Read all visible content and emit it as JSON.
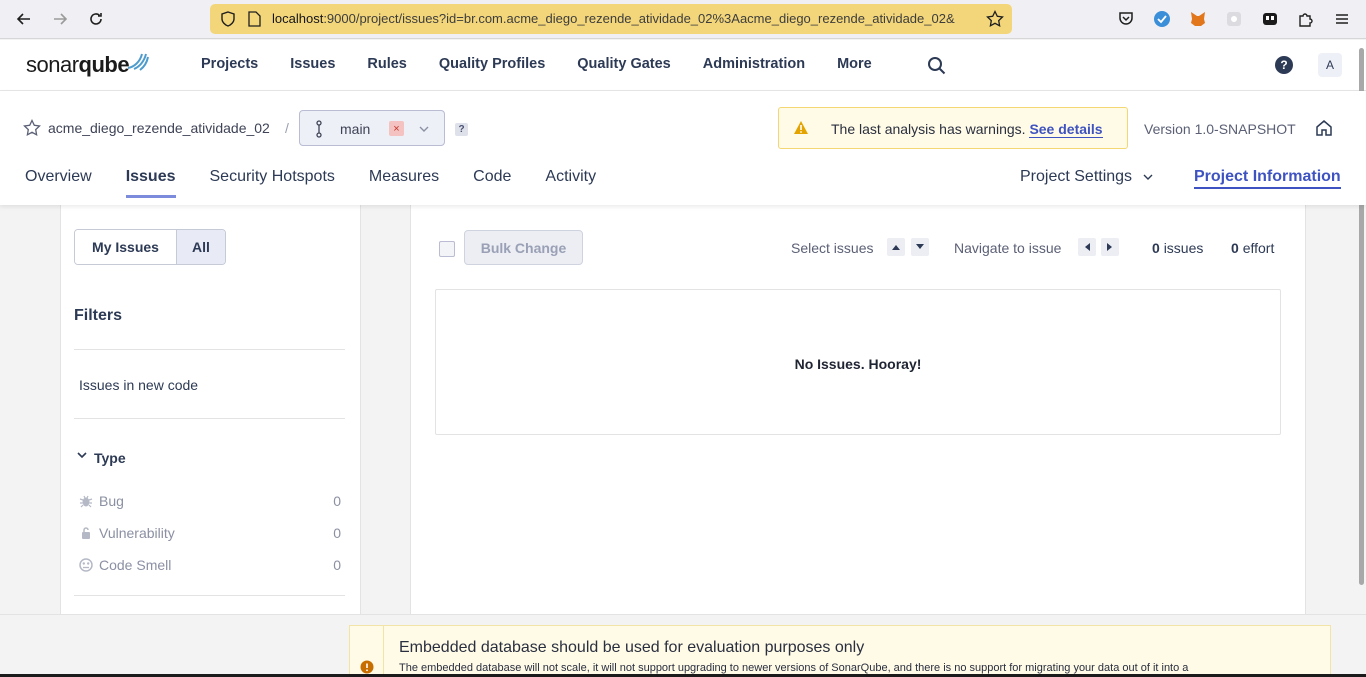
{
  "browser": {
    "url_host": "localhost",
    "url_rest": ":9000/project/issues?id=br.com.acme_diego_rezende_atividade_02%3Aacme_diego_rezende_atividade_02&"
  },
  "header": {
    "logo_light": "sonar",
    "logo_bold": "qube",
    "nav": [
      "Projects",
      "Issues",
      "Rules",
      "Quality Profiles",
      "Quality Gates",
      "Administration",
      "More"
    ],
    "avatar": "A"
  },
  "project": {
    "name": "acme_diego_rezende_atividade_02",
    "separator": "/",
    "branch": "main",
    "branch_remove": "×",
    "help": "?",
    "warning_text": "The last analysis has warnings.",
    "warning_link": "See details",
    "version": "Version 1.0-SNAPSHOT",
    "tabs": [
      "Overview",
      "Issues",
      "Security Hotspots",
      "Measures",
      "Code",
      "Activity"
    ],
    "settings": "Project Settings",
    "info": "Project Information"
  },
  "sidebar": {
    "my_issues": "My Issues",
    "all": "All",
    "filters_title": "Filters",
    "new_code": "Issues in new code",
    "type_title": "Type",
    "types": [
      {
        "label": "Bug",
        "count": "0",
        "icon": "bug-icon"
      },
      {
        "label": "Vulnerability",
        "count": "0",
        "icon": "lock-icon"
      },
      {
        "label": "Code Smell",
        "count": "0",
        "icon": "code-smell-icon"
      }
    ]
  },
  "main": {
    "bulk_change": "Bulk Change",
    "select_issues": "Select issues",
    "navigate": "Navigate to issue",
    "issues_count": "0",
    "issues_label": "issues",
    "effort_count": "0",
    "effort_label": "effort",
    "empty": "No Issues. Hooray!"
  },
  "footer": {
    "title": "Embedded database should be used for evaluation purposes only",
    "text": "The embedded database will not scale, it will not support upgrading to newer versions of SonarQube, and there is no support for migrating your data out of it into a"
  }
}
